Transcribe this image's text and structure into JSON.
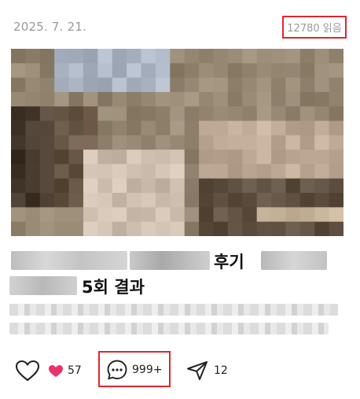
{
  "post": {
    "date": "2025. 7. 21.",
    "read_count": "12780 읽음",
    "title_word_1": "후기",
    "title_word_2": "5회 결과"
  },
  "actions": {
    "likes_count": "57",
    "comments_count": "999+",
    "shares_count": "12"
  },
  "colors": {
    "highlight_border": "#e0262c",
    "heart_pink": "#e8336b",
    "muted_text": "#9a9a9a"
  },
  "icons": {
    "like": "heart-outline-icon",
    "reactions": "heart-filled-icon",
    "comment": "speech-bubble-icon",
    "share": "paper-plane-icon"
  }
}
